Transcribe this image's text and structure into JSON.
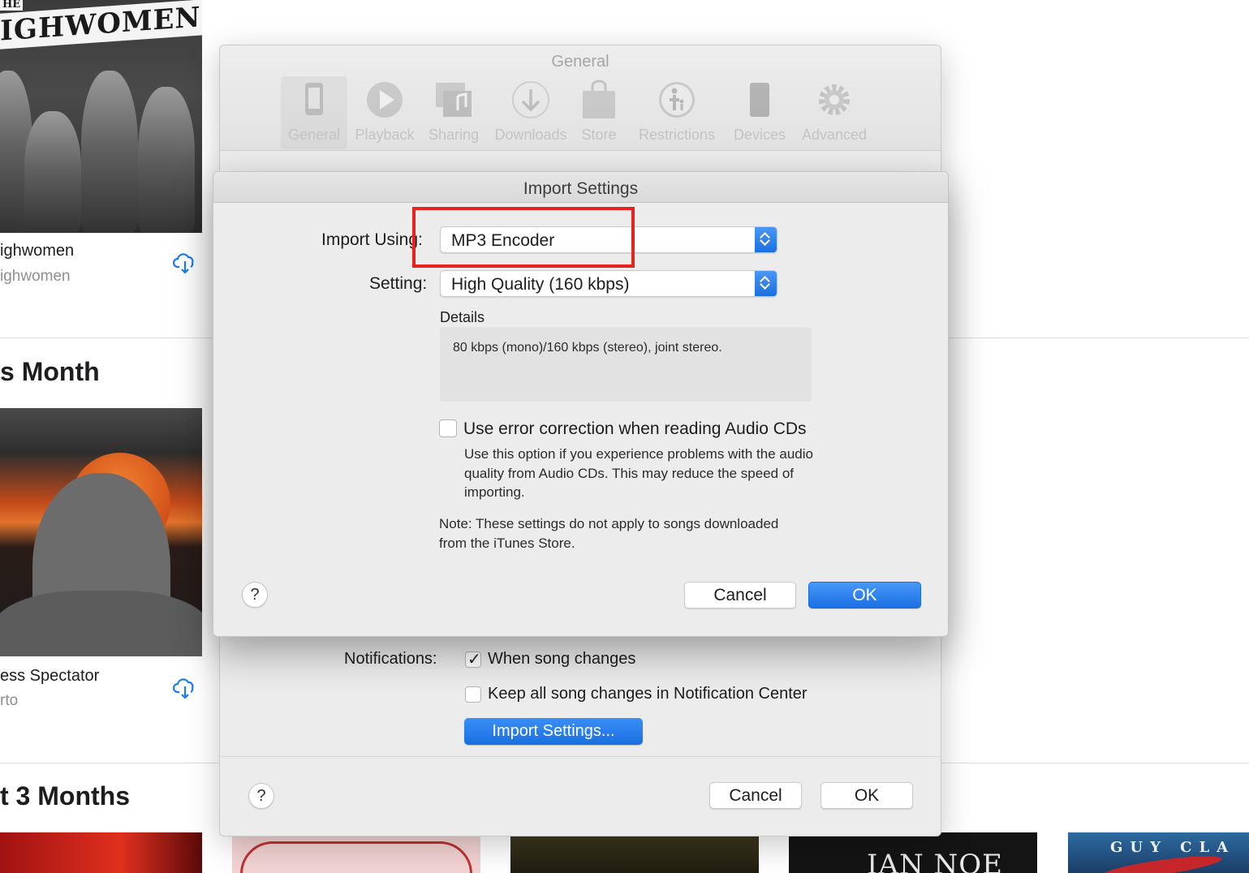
{
  "library": {
    "album1": {
      "art_text_small": "HE",
      "art_text": "IGHWOMEN",
      "title": "ighwomen",
      "subtitle": "ighwomen"
    },
    "section1": "s Month",
    "album2": {
      "title": "ess Spectator",
      "subtitle": "rto"
    },
    "section2": "t 3 Months",
    "bottom_art": {
      "album4_text": "IAN NOE",
      "album5_text": "GUY CLA"
    }
  },
  "prefs": {
    "title": "General",
    "toolbar": [
      {
        "label": "General",
        "icon": "phone-icon"
      },
      {
        "label": "Playback",
        "icon": "play-icon"
      },
      {
        "label": "Sharing",
        "icon": "sharing-icon"
      },
      {
        "label": "Downloads",
        "icon": "download-icon"
      },
      {
        "label": "Store",
        "icon": "store-bag-icon"
      },
      {
        "label": "Restrictions",
        "icon": "restrictions-icon"
      },
      {
        "label": "Devices",
        "icon": "device-icon"
      },
      {
        "label": "Advanced",
        "icon": "gear-icon"
      }
    ],
    "notifications_label": "Notifications:",
    "notif_check1_label": "When song changes",
    "notif_check1_checked": true,
    "notif_check2_label": "Keep all song changes in Notification Center",
    "notif_check2_checked": false,
    "import_settings_button": "Import Settings...",
    "help": "?",
    "cancel": "Cancel",
    "ok": "OK"
  },
  "import_sheet": {
    "title": "Import Settings",
    "import_using_label": "Import Using:",
    "import_using_value": "MP3 Encoder",
    "setting_label": "Setting:",
    "setting_value": "High Quality (160 kbps)",
    "details_label": "Details",
    "details_text": "80 kbps (mono)/160 kbps (stereo), joint stereo.",
    "error_correction_label": "Use error correction when reading Audio CDs",
    "error_correction_checked": false,
    "error_correction_help": "Use this option if you experience problems with the audio quality from Audio CDs. This may reduce the speed of importing.",
    "note": "Note: These settings do not apply to songs downloaded from the iTunes Store.",
    "help": "?",
    "cancel": "Cancel",
    "ok": "OK"
  },
  "colors": {
    "accent_blue": "#1b70e3",
    "highlight_red": "#e8231f"
  }
}
